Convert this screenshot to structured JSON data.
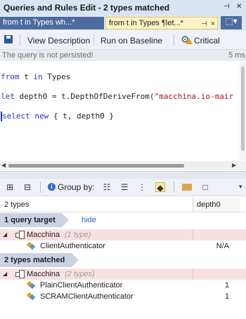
{
  "window": {
    "title": "Queries and Rules Edit  - 2 types matched",
    "pin_icon": "pin-icon",
    "close_icon": "close-icon"
  },
  "tabs": [
    {
      "label": "from t in Types wh...*"
    },
    {
      "label": "from t in Types ¶let...*",
      "pin": "⊣",
      "close": "×"
    }
  ],
  "toolbar": {
    "view_description": "View Description",
    "run_on_baseline": "Run on Baseline",
    "critical": "Critical"
  },
  "status": {
    "message": "The query is not persisted!",
    "time": "5 ms"
  },
  "code": {
    "line1": {
      "kw1": "from",
      "t": " t ",
      "kw2": "in",
      "rest": " Types"
    },
    "line2": {
      "kw": "let",
      "rest": " depth0 = t.DepthOfDeriveFrom(",
      "str": "\"macchina.io-mair"
    },
    "line3": {
      "kw1": "select",
      "sp": " ",
      "kw2": "new",
      "rest": " { t, depth0 }"
    }
  },
  "results_toolbar": {
    "group_by": "Group by:"
  },
  "grid": {
    "header": {
      "count": "2 types",
      "column": "depth0"
    },
    "sections": [
      {
        "label": "1 query target",
        "action": "hide",
        "group": {
          "name": "Macchina",
          "count": "(1 type)"
        },
        "rows": [
          {
            "name": "ClientAuthenticator",
            "value": "N/A"
          }
        ]
      },
      {
        "label": "2 types matched",
        "group": {
          "name": "Macchina",
          "count": "(2 types)"
        },
        "rows": [
          {
            "name": "PlainClientAuthenticator",
            "value": "1"
          },
          {
            "name": "SCRAMClientAuthenticator",
            "value": "1"
          }
        ]
      }
    ]
  },
  "colors": {
    "accent": "#4e6ba0",
    "keyword": "#1f35c9",
    "string": "#a31515",
    "section": "#c9d3e4",
    "group_row": "#f8e1e1"
  }
}
